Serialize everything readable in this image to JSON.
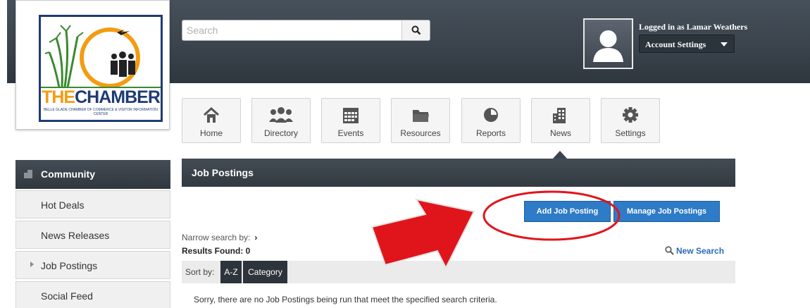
{
  "logo": {
    "brand_the": "THE",
    "brand_chamber": "CHAMBER",
    "subtitle": "BELLE GLADE CHAMBER OF COMMERCE & VISITOR INFORMATION CENTER"
  },
  "search": {
    "placeholder": "Search",
    "icon": "search-icon"
  },
  "account": {
    "logged_in_text": "Logged in as Lamar Weathers",
    "settings_label": "Account Settings"
  },
  "nav": {
    "tiles": [
      {
        "label": "Home",
        "icon": "home-icon"
      },
      {
        "label": "Directory",
        "icon": "users-icon"
      },
      {
        "label": "Events",
        "icon": "calendar-icon"
      },
      {
        "label": "Resources",
        "icon": "folder-icon"
      },
      {
        "label": "Reports",
        "icon": "pie-chart-icon"
      },
      {
        "label": "News",
        "icon": "building-icon"
      },
      {
        "label": "Settings",
        "icon": "gear-icon"
      }
    ],
    "active": "News"
  },
  "sidebar": {
    "heading": "Community",
    "items": [
      {
        "label": "Hot Deals"
      },
      {
        "label": "News Releases"
      },
      {
        "label": "Job Postings"
      },
      {
        "label": "Social Feed"
      }
    ]
  },
  "main": {
    "section_title": "Job Postings",
    "add_button": "Add Job Posting",
    "manage_button": "Manage Job Postings",
    "narrow_search": "Narrow search by:",
    "results_found": "Results Found: 0",
    "new_search": "New Search",
    "sort_label": "Sort by:",
    "sort_options": [
      "A-Z",
      "Category"
    ],
    "empty_message": "Sorry, there are no Job Postings being run that meet the specified search criteria."
  },
  "colors": {
    "header": "#3b444d",
    "accent_blue": "#2e7bc7",
    "annotation_red": "#e0151b",
    "logo_orange": "#f39c12",
    "logo_navy": "#1f3b73"
  }
}
